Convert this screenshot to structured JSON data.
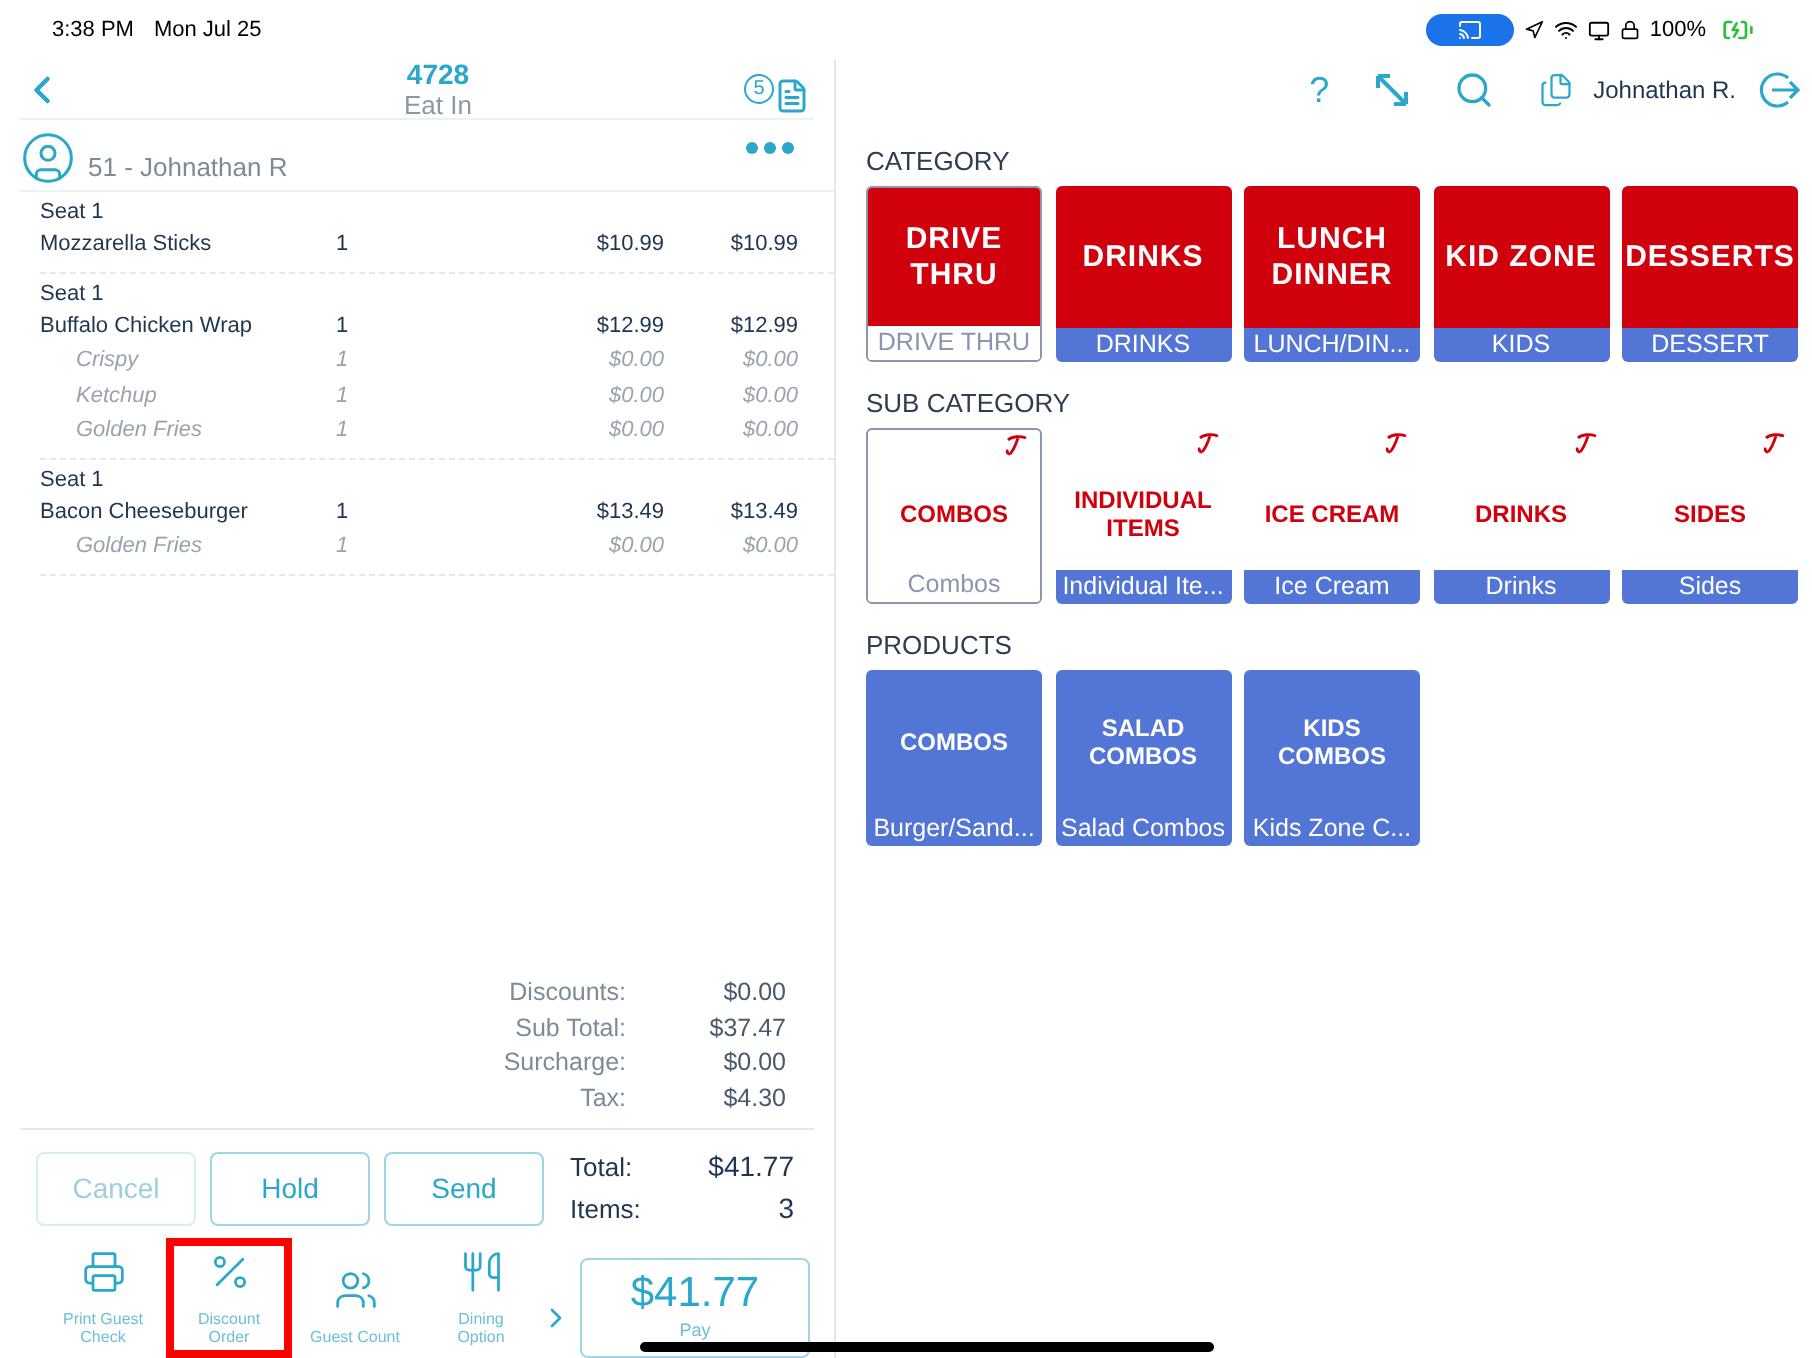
{
  "status_bar": {
    "time": "3:38 PM",
    "date": "Mon Jul 25",
    "battery": "100%"
  },
  "order_header": {
    "number": "4728",
    "type": "Eat In",
    "badge": "5"
  },
  "customer": {
    "name": "51 - Johnathan R"
  },
  "order_lines": [
    {
      "seat": "Seat 1",
      "name": "Mozzarella Sticks",
      "qty": "1",
      "price": "$10.99",
      "total": "$10.99"
    },
    {
      "seat": "Seat 1",
      "name": "Buffalo Chicken Wrap",
      "qty": "1",
      "price": "$12.99",
      "total": "$12.99",
      "modifiers": [
        {
          "name": "Crispy",
          "qty": "1",
          "price": "$0.00",
          "total": "$0.00"
        },
        {
          "name": "Ketchup",
          "qty": "1",
          "price": "$0.00",
          "total": "$0.00"
        },
        {
          "name": "Golden Fries",
          "qty": "1",
          "price": "$0.00",
          "total": "$0.00"
        }
      ]
    },
    {
      "seat": "Seat 1",
      "name": "Bacon Cheeseburger",
      "qty": "1",
      "price": "$13.49",
      "total": "$13.49",
      "modifiers": [
        {
          "name": "Golden Fries",
          "qty": "1",
          "price": "$0.00",
          "total": "$0.00"
        }
      ]
    }
  ],
  "summary": [
    {
      "label": "Discounts:",
      "value": "$0.00"
    },
    {
      "label": "Sub Total:",
      "value": "$37.47"
    },
    {
      "label": "Surcharge:",
      "value": "$0.00"
    },
    {
      "label": "Tax:",
      "value": "$4.30"
    }
  ],
  "actions": [
    {
      "label": "Cancel",
      "disabled": true
    },
    {
      "label": "Hold",
      "disabled": false
    },
    {
      "label": "Send",
      "disabled": false
    }
  ],
  "totals": [
    {
      "label": "Total:",
      "value": "$41.77"
    },
    {
      "label": "Items:",
      "value": "3"
    }
  ],
  "toolbar": [
    {
      "kind": "print",
      "label": "Print Guest Check",
      "highlighted": false
    },
    {
      "kind": "discount",
      "label": "Discount Order",
      "highlighted": true
    },
    {
      "kind": "guests",
      "label": "Guest Count",
      "highlighted": false
    },
    {
      "kind": "dining",
      "label": "Dining Option",
      "highlighted": false
    }
  ],
  "pay_button": {
    "amount": "$41.77",
    "label": "Pay"
  },
  "top_bar": {
    "help": "?",
    "user": "Johnathan R."
  },
  "category": {
    "heading": "CATEGORY",
    "tiles": [
      {
        "art": "DRIVE THRU",
        "label": "DRIVE THRU",
        "selected": true
      },
      {
        "art": "DRINKS",
        "label": "DRINKS",
        "selected": false
      },
      {
        "art": "LUNCH DINNER",
        "label": "LUNCH/DIN...",
        "selected": false
      },
      {
        "art": "KID ZONE",
        "label": "KIDS",
        "selected": false
      },
      {
        "art": "DESSERTS",
        "label": "DESSERT",
        "selected": false
      }
    ]
  },
  "sub_category": {
    "heading": "SUB CATEGORY",
    "tiles": [
      {
        "art": "COMBOS",
        "label": "Combos",
        "selected": true
      },
      {
        "art": "INDIVIDUAL ITEMS",
        "label": "Individual Ite...",
        "selected": false
      },
      {
        "art": "ICE CREAM",
        "label": "Ice Cream",
        "selected": false
      },
      {
        "art": "DRINKS",
        "label": "Drinks",
        "selected": false
      },
      {
        "art": "SIDES",
        "label": "Sides",
        "selected": false
      }
    ]
  },
  "products": {
    "heading": "PRODUCTS",
    "tiles": [
      {
        "art": "COMBOS",
        "label": "Burger/Sand..."
      },
      {
        "art": "SALAD COMBOS",
        "label": "Salad Combos"
      },
      {
        "art": "KIDS COMBOS",
        "label": "Kids Zone C..."
      }
    ]
  }
}
